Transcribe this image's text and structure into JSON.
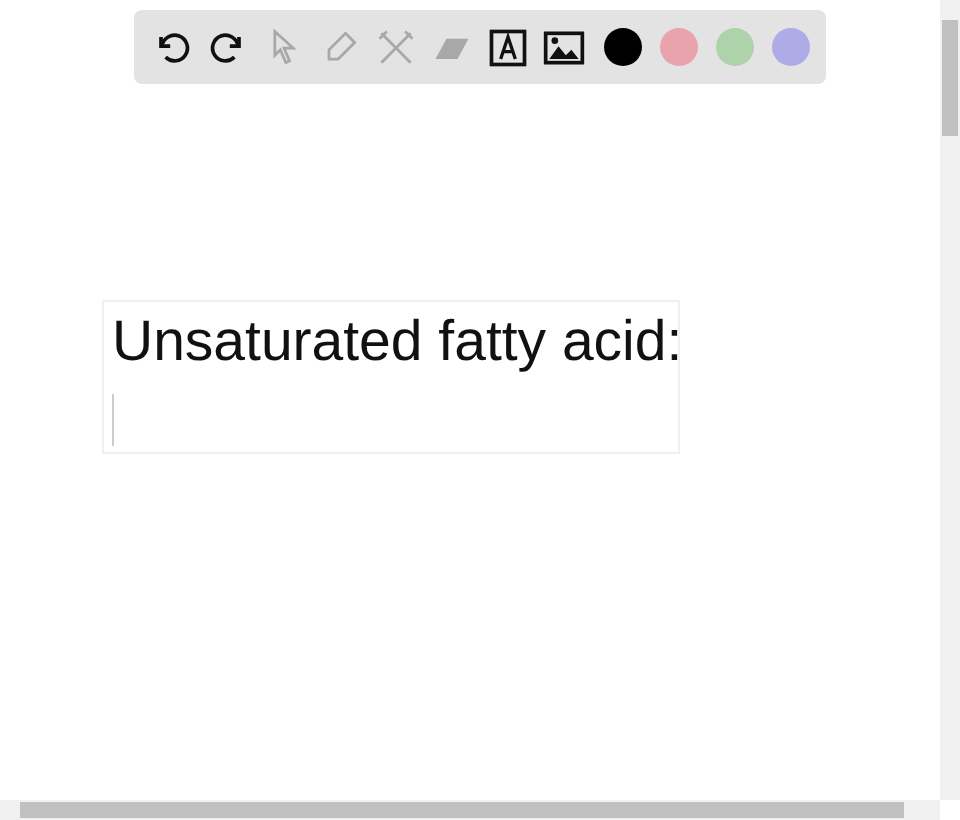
{
  "toolbar": {
    "tools": [
      {
        "kind": "undo",
        "disabled": false
      },
      {
        "kind": "redo",
        "disabled": false
      },
      {
        "kind": "pointer",
        "disabled": true
      },
      {
        "kind": "pen",
        "disabled": true
      },
      {
        "kind": "tools",
        "disabled": true
      },
      {
        "kind": "eraser",
        "disabled": true
      },
      {
        "kind": "text",
        "disabled": false
      },
      {
        "kind": "image",
        "disabled": false
      }
    ],
    "colors": [
      {
        "color": "#000000"
      },
      {
        "color": "#e8a3ad"
      },
      {
        "color": "#aed2a9"
      },
      {
        "color": "#aeabe6"
      }
    ]
  },
  "canvas": {
    "text_box": {
      "text": "Unsaturated fatty acid:"
    }
  }
}
